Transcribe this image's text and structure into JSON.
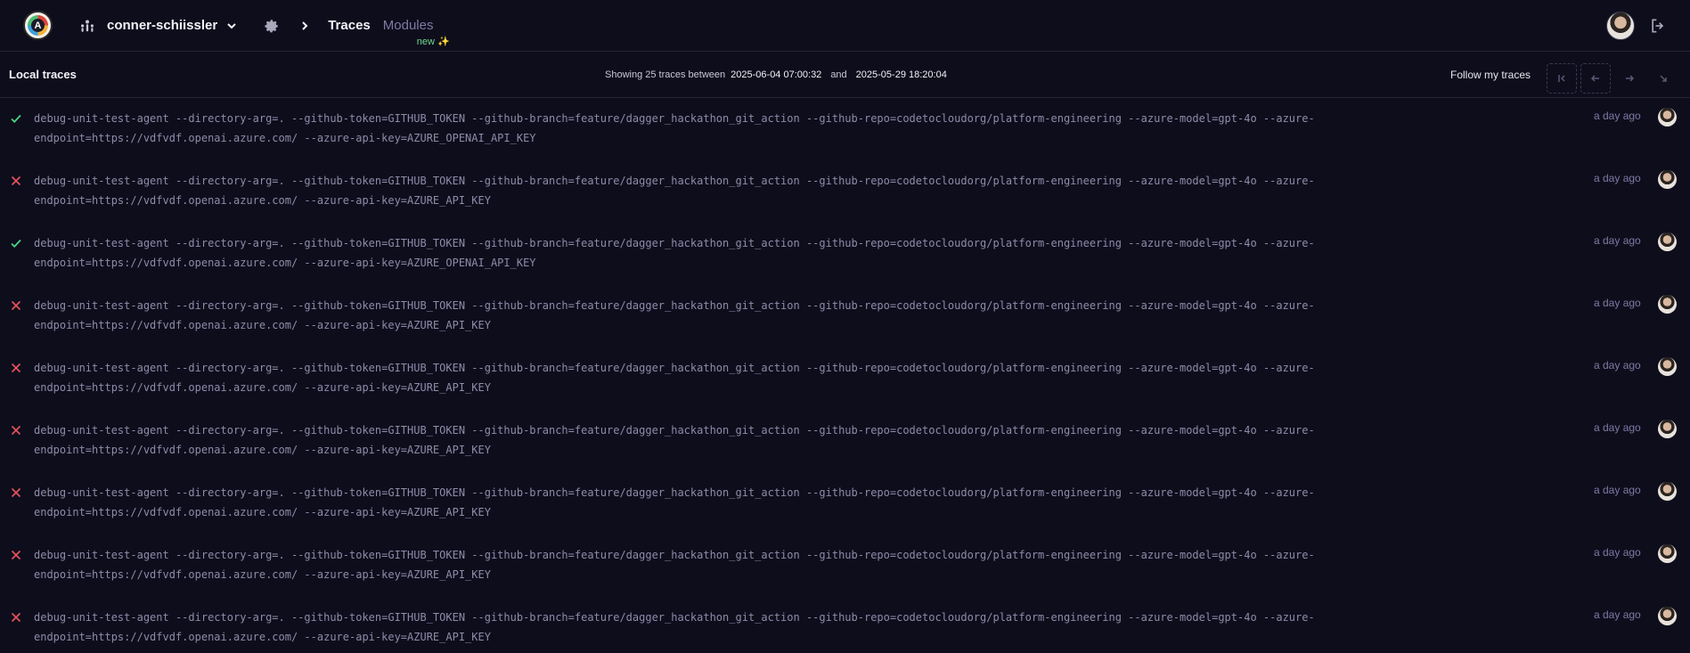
{
  "header": {
    "logo_letter": "A",
    "org_name": "conner-schiissler",
    "breadcrumb_current": "Traces",
    "breadcrumb_modules": "Modules",
    "new_badge": "new ✨"
  },
  "subheader": {
    "title": "Local traces",
    "showing_prefix": "Showing 25 traces between",
    "start_date": "2025-06-04 07:00:32",
    "and_word": "and",
    "end_date": "2025-05-29 18:20:04",
    "follow_label": "Follow my traces"
  },
  "colors": {
    "success": "#4bd682",
    "failure": "#e0525a",
    "background": "#0e0d1c"
  },
  "traces": [
    {
      "status": "success",
      "line1": "debug-unit-test-agent --directory-arg=. --github-token=GITHUB_TOKEN --github-branch=feature/dagger_hackathon_git_action --github-repo=codetocloudorg/platform-engineering --azure-model=gpt-4o --azure-",
      "line2": "endpoint=https://vdfvdf.openai.azure.com/ --azure-api-key=AZURE_OPENAI_API_KEY",
      "time": "a day ago"
    },
    {
      "status": "failure",
      "line1": "debug-unit-test-agent --directory-arg=. --github-token=GITHUB_TOKEN --github-branch=feature/dagger_hackathon_git_action --github-repo=codetocloudorg/platform-engineering --azure-model=gpt-4o --azure-",
      "line2": "endpoint=https://vdfvdf.openai.azure.com/ --azure-api-key=AZURE_API_KEY",
      "time": "a day ago"
    },
    {
      "status": "success",
      "line1": "debug-unit-test-agent --directory-arg=. --github-token=GITHUB_TOKEN --github-branch=feature/dagger_hackathon_git_action --github-repo=codetocloudorg/platform-engineering --azure-model=gpt-4o --azure-",
      "line2": "endpoint=https://vdfvdf.openai.azure.com/ --azure-api-key=AZURE_OPENAI_API_KEY",
      "time": "a day ago"
    },
    {
      "status": "failure",
      "line1": "debug-unit-test-agent --directory-arg=. --github-token=GITHUB_TOKEN --github-branch=feature/dagger_hackathon_git_action --github-repo=codetocloudorg/platform-engineering --azure-model=gpt-4o --azure-",
      "line2": "endpoint=https://vdfvdf.openai.azure.com/ --azure-api-key=AZURE_API_KEY",
      "time": "a day ago"
    },
    {
      "status": "failure",
      "line1": "debug-unit-test-agent --directory-arg=. --github-token=GITHUB_TOKEN --github-branch=feature/dagger_hackathon_git_action --github-repo=codetocloudorg/platform-engineering --azure-model=gpt-4o --azure-",
      "line2": "endpoint=https://vdfvdf.openai.azure.com/ --azure-api-key=AZURE_API_KEY",
      "time": "a day ago"
    },
    {
      "status": "failure",
      "line1": "debug-unit-test-agent --directory-arg=. --github-token=GITHUB_TOKEN --github-branch=feature/dagger_hackathon_git_action --github-repo=codetocloudorg/platform-engineering --azure-model=gpt-4o --azure-",
      "line2": "endpoint=https://vdfvdf.openai.azure.com/ --azure-api-key=AZURE_API_KEY",
      "time": "a day ago"
    },
    {
      "status": "failure",
      "line1": "debug-unit-test-agent --directory-arg=. --github-token=GITHUB_TOKEN --github-branch=feature/dagger_hackathon_git_action --github-repo=codetocloudorg/platform-engineering --azure-model=gpt-4o --azure-",
      "line2": "endpoint=https://vdfvdf.openai.azure.com/ --azure-api-key=AZURE_API_KEY",
      "time": "a day ago"
    },
    {
      "status": "failure",
      "line1": "debug-unit-test-agent --directory-arg=. --github-token=GITHUB_TOKEN --github-branch=feature/dagger_hackathon_git_action --github-repo=codetocloudorg/platform-engineering --azure-model=gpt-4o --azure-",
      "line2": "endpoint=https://vdfvdf.openai.azure.com/ --azure-api-key=AZURE_API_KEY",
      "time": "a day ago"
    },
    {
      "status": "failure",
      "line1": "debug-unit-test-agent --directory-arg=. --github-token=GITHUB_TOKEN --github-branch=feature/dagger_hackathon_git_action --github-repo=codetocloudorg/platform-engineering --azure-model=gpt-4o --azure-",
      "line2": "endpoint=https://vdfvdf.openai.azure.com/ --azure-api-key=AZURE_API_KEY",
      "time": "a day ago"
    }
  ]
}
